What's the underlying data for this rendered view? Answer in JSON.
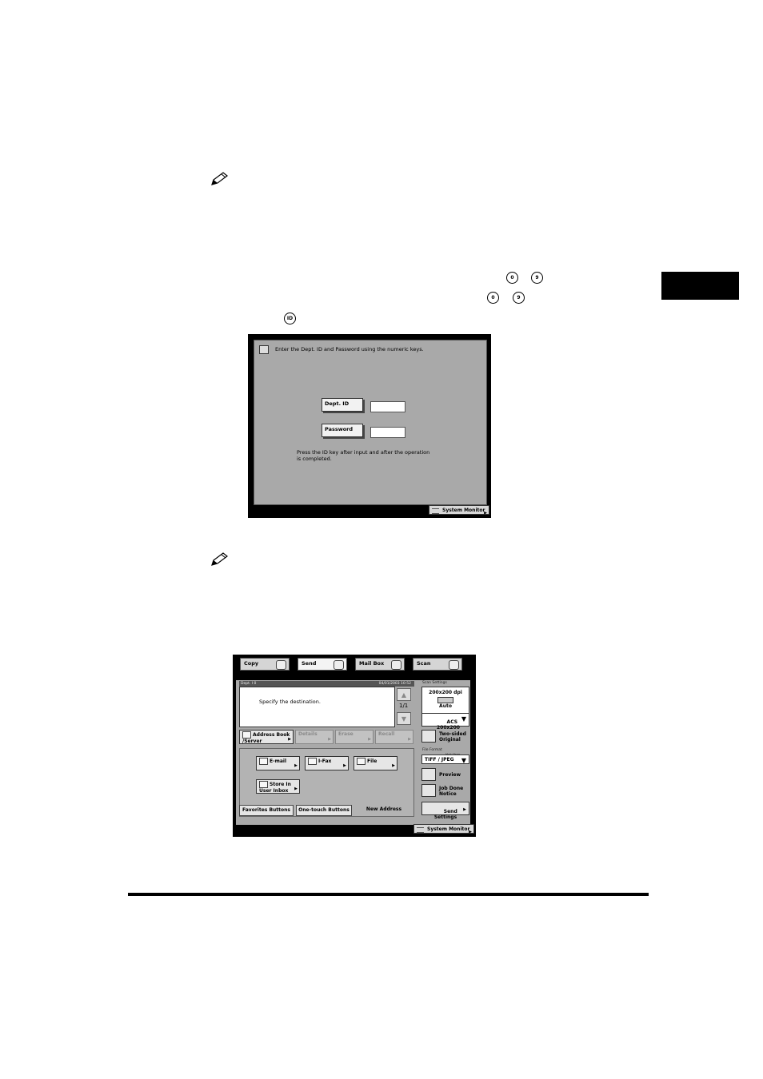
{
  "screen1": {
    "message": "Enter the Dept. ID and Password using the numeric keys.",
    "dept_id_label": "Dept. ID",
    "password_label": "Password",
    "note": "Press the ID key after input and after the operation\nis completed.",
    "system_monitor": "System Monitor"
  },
  "screen2": {
    "tabs": [
      "Copy",
      "Send",
      "Mail Box",
      "Scan"
    ],
    "status": {
      "left": "Dept. I   0",
      "right": "04/01/2003  10:52"
    },
    "destination_prompt": "Specify the destination.",
    "page_indicator": "1/1",
    "buttons_row": [
      "Address Book\n/Server",
      "Details",
      "Erase",
      "Recall"
    ],
    "send_types": [
      "E-mail",
      "I-Fax",
      "File",
      "Store In\nUser Inbox"
    ],
    "bottom_tabs": [
      "Favorites Buttons",
      "One-touch Buttons",
      "New Address"
    ],
    "scan_settings": {
      "label": "Scan Settings",
      "resolution": "200x200 dpi",
      "mode": "Auto",
      "acs": "ACS\n200x200"
    },
    "two_sided": "Two-sided\nOriginal",
    "file_format": {
      "label": "File Format",
      "small_label": "Multi Page",
      "value": "TIFF  / JPEG"
    },
    "preview": "Preview",
    "job_done": "Job Done\nNotice",
    "send_settings": "Send\nSettings",
    "system_monitor": "System Monitor"
  }
}
